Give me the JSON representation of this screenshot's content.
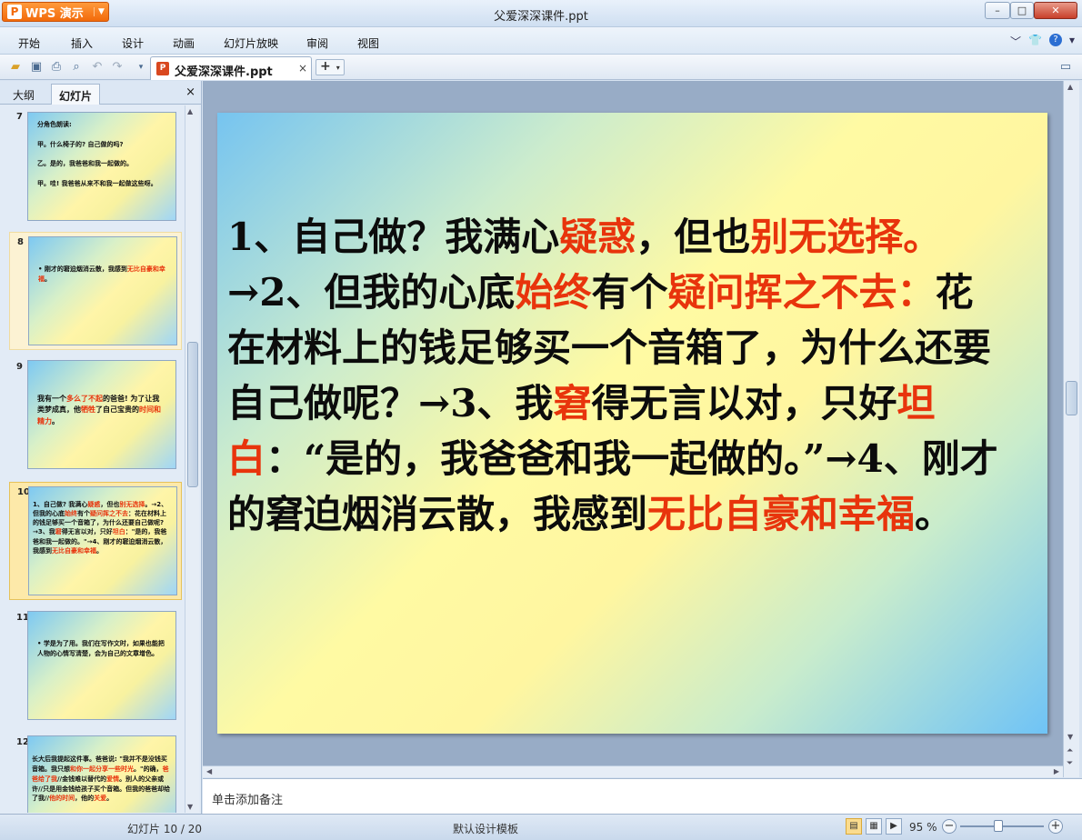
{
  "app": {
    "button_label": "WPS 演示",
    "title": "父爱深深课件.ppt"
  },
  "window_controls": {
    "minimize": "–",
    "maximize": "□",
    "close": "✕"
  },
  "menu": [
    "开始",
    "插入",
    "设计",
    "动画",
    "幻灯片放映",
    "审阅",
    "视图"
  ],
  "toolbar": {
    "doc_tab": "父爱深深课件.ppt",
    "doc_tab_close": "×",
    "new_tab": "+"
  },
  "panel": {
    "tab_outline": "大纲",
    "tab_slides": "幻灯片",
    "close": "×"
  },
  "thumbnails": [
    {
      "num": "7",
      "segments": [
        [
          "分角色朗读:",
          ""
        ],
        [
          "\n\n甲。什么椅子的? 自己做的吗?",
          ""
        ],
        [
          "\n\n乙。是的，我爸爸和我一起做的。",
          ""
        ],
        [
          "\n\n甲。哇! 我爸爸从来不和我一起做这些呀。",
          ""
        ]
      ]
    },
    {
      "num": "8",
      "segments": [
        [
          "• 刚才的窘迫烟消云散，我感到",
          ""
        ],
        [
          "无比自豪和幸福",
          "r"
        ],
        [
          "。",
          ""
        ]
      ]
    },
    {
      "num": "9",
      "segments": [
        [
          "我有一个",
          ""
        ],
        [
          "多么了不起",
          "r"
        ],
        [
          "的爸爸! 为了让我类梦成真，他",
          ""
        ],
        [
          "牺牲",
          "r"
        ],
        [
          "了自己宝贵的",
          ""
        ],
        [
          "时间和精力",
          "r"
        ],
        [
          "。",
          ""
        ]
      ]
    },
    {
      "num": "10",
      "segments": [
        [
          "1、自己做? 我满心",
          ""
        ],
        [
          "疑惑",
          "r"
        ],
        [
          "，但也",
          ""
        ],
        [
          "别无选择",
          "r"
        ],
        [
          "。→2、但我的心底",
          ""
        ],
        [
          "始终",
          "r"
        ],
        [
          "有个",
          ""
        ],
        [
          "疑问挥之不去",
          "r"
        ],
        [
          "：花在材料上的钱足够买一个音箱了，为什么还要自己做呢? →3、我",
          ""
        ],
        [
          "窘",
          "r"
        ],
        [
          "得无言以对，只好",
          ""
        ],
        [
          "坦白",
          "r"
        ],
        [
          "：\"是的，我爸爸和我一起做的。\"→4、刚才的窘迫烟消云散，我感到",
          ""
        ],
        [
          "无比自豪和幸福",
          "r"
        ],
        [
          "。",
          ""
        ]
      ]
    },
    {
      "num": "11",
      "segments": [
        [
          "• 学是为了用。我们在写作文时，如果也能把人物的心情写清楚，会为自己的文章增色。",
          ""
        ]
      ]
    },
    {
      "num": "12",
      "segments": [
        [
          "长大后我提起这件事。爸爸说: \"我并不是没钱买音箱。我只想",
          ""
        ],
        [
          "和你一起分享一些时光",
          "r"
        ],
        [
          "。\"的确，",
          ""
        ],
        [
          "爸爸给了我",
          "r"
        ],
        [
          "//金钱难以替代的",
          ""
        ],
        [
          "爱情",
          "r"
        ],
        [
          "。别人的父亲或许//只是用金钱给孩子买个音箱。但我的爸爸却给了我//",
          ""
        ],
        [
          "他的时间",
          "r"
        ],
        [
          "，他的",
          ""
        ],
        [
          "关爱",
          "r"
        ],
        [
          "。",
          ""
        ]
      ]
    }
  ],
  "slide": {
    "segments": [
      [
        "1、自己做？我满心",
        ""
      ],
      [
        "疑惑",
        "r"
      ],
      [
        "，但也",
        ""
      ],
      [
        "别无选择。",
        "r"
      ],
      [
        "→2、但我的心底",
        ""
      ],
      [
        "始终",
        "r"
      ],
      [
        "有个",
        ""
      ],
      [
        "疑问挥之不去：",
        "r"
      ],
      [
        "花在材料上的钱足够买一个音箱了，为什么还要自己做呢？→3、我",
        ""
      ],
      [
        "窘",
        "r"
      ],
      [
        "得无言以对，只好",
        ""
      ],
      [
        "坦白",
        "r"
      ],
      [
        "：“是的，我爸爸和我一起做的。”→4、刚才的窘迫烟消云散，我感到",
        ""
      ],
      [
        "无比自豪和幸福",
        "r"
      ],
      [
        "。",
        ""
      ]
    ]
  },
  "notes": {
    "placeholder": "单击添加备注"
  },
  "status": {
    "slide_position": "幻灯片 10 / 20",
    "template": "默认设计模板",
    "zoom": "95 %"
  },
  "colors": {
    "accent_red": "#e8340c",
    "app_orange": "#f26a0a"
  }
}
